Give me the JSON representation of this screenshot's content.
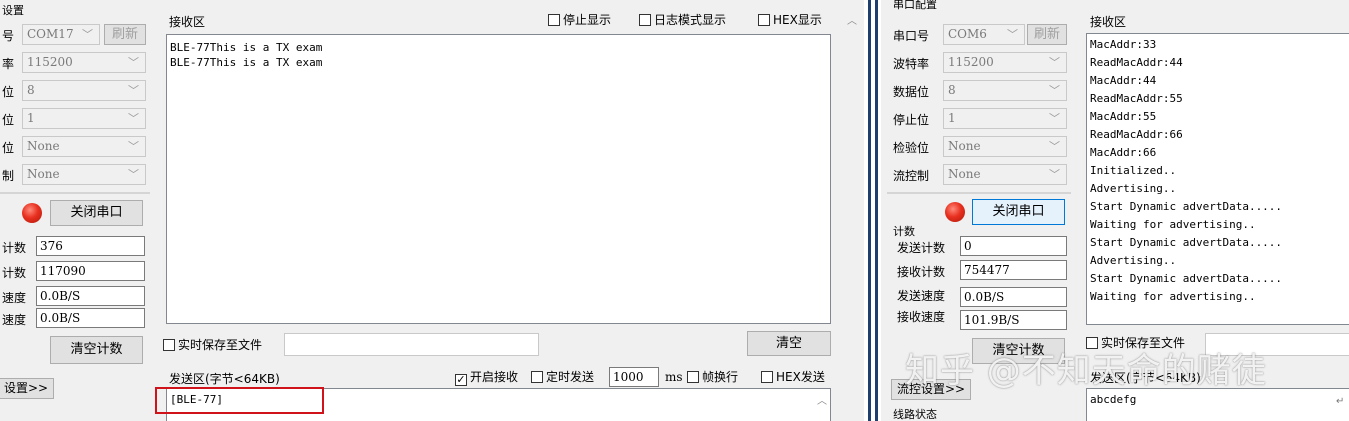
{
  "left_app": {
    "section_title_fragment": "设置",
    "settings": [
      {
        "label_fragment": "号",
        "value": "COM17"
      },
      {
        "label_fragment": "率",
        "value": "115200"
      },
      {
        "label_fragment": "位",
        "value": "8"
      },
      {
        "label_fragment": "位",
        "value": "1"
      },
      {
        "label_fragment": "位",
        "value": "None"
      },
      {
        "label_fragment": "制",
        "value": "None"
      }
    ],
    "refresh_button": "刷新",
    "close_port_button": "关闭串口",
    "counters": [
      {
        "label_fragment": "计数",
        "value": "376"
      },
      {
        "label_fragment": "计数",
        "value": "117090"
      },
      {
        "label_fragment": "速度",
        "value": "0.0B/S"
      },
      {
        "label_fragment": "速度",
        "value": "0.0B/S"
      }
    ],
    "clear_count_button": "清空计数",
    "settings_toggle_fragment": "设置>>",
    "receive": {
      "title": "接收区",
      "stop_display": "停止显示",
      "log_mode": "日志模式显示",
      "hex_display": "HEX显示",
      "lines": [
        "BLE-77This is a TX exam",
        "BLE-77This is a TX exam"
      ]
    },
    "save_to_file": "实时保存至文件",
    "clear_button": "清空",
    "send": {
      "title": "发送区(字节<64KB)",
      "start_receive": "开启接收",
      "start_receive_checked": true,
      "timed_send": "定时发送",
      "interval": "1000",
      "ms_label": "ms",
      "frame_newline": "帧换行",
      "hex_send": "HEX发送",
      "content": "[BLE-77]"
    }
  },
  "right_app": {
    "section_title": "串口配置",
    "settings": [
      {
        "label": "串口号",
        "value": "COM6"
      },
      {
        "label": "波特率",
        "value": "115200"
      },
      {
        "label": "数据位",
        "value": "8"
      },
      {
        "label": "停止位",
        "value": "1"
      },
      {
        "label": "检验位",
        "value": "None"
      },
      {
        "label": "流控制",
        "value": "None"
      }
    ],
    "refresh_button": "刷新",
    "close_port_button": "关闭串口",
    "counters_title": "计数",
    "counters": [
      {
        "label": "发送计数",
        "value": "0"
      },
      {
        "label": "接收计数",
        "value": "754477"
      },
      {
        "label": "发送速度",
        "value": "0.0B/S"
      },
      {
        "label": "接收速度",
        "value": "101.9B/S"
      }
    ],
    "clear_count_button": "清空计数",
    "flow_settings": "流控设置>>",
    "line_status_fragment": "线路状态",
    "receive": {
      "title": "接收区",
      "lines": [
        "MacAddr:33",
        "ReadMacAddr:44",
        "MacAddr:44",
        "ReadMacAddr:55",
        "MacAddr:55",
        "ReadMacAddr:66",
        "MacAddr:66",
        "Initialized..",
        "Advertising..",
        "Start Dynamic advertData.....",
        "Waiting for advertising..",
        "Start Dynamic advertData.....",
        "Advertising..",
        "Start Dynamic advertData.....",
        "Waiting for advertising.."
      ]
    },
    "save_to_file": "实时保存至文件",
    "send_title": "发送区(字节<64KB)",
    "send_content": "abcdefg"
  },
  "watermark": "知乎 @不知天命的赌徒",
  "colors": {
    "highlight_box": "#d0121b",
    "divider": "#1c3f6e",
    "led": "#e83020"
  }
}
